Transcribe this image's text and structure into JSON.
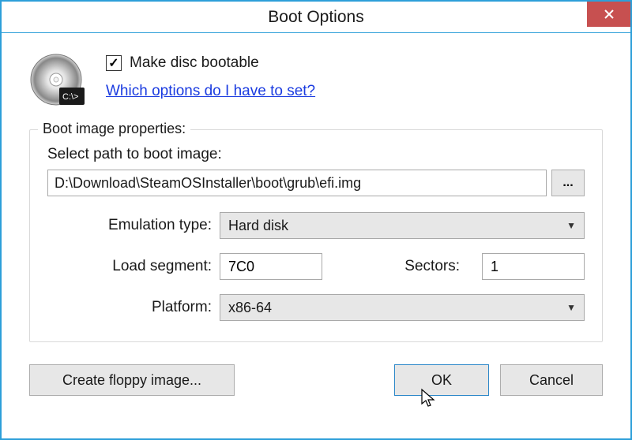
{
  "title": "Boot Options",
  "checkbox": {
    "label": "Make disc bootable",
    "checked": true
  },
  "help_link": "Which options do I have to set?",
  "group": {
    "legend": "Boot image properties:",
    "path_label": "Select path to boot image:",
    "path_value": "D:\\Download\\SteamOSInstaller\\boot\\grub\\efi.img",
    "browse_label": "...",
    "emulation_label": "Emulation type:",
    "emulation_value": "Hard disk",
    "load_segment_label": "Load segment:",
    "load_segment_value": "7C0",
    "sectors_label": "Sectors:",
    "sectors_value": "1",
    "platform_label": "Platform:",
    "platform_value": "x86-64"
  },
  "buttons": {
    "floppy": "Create floppy image...",
    "ok": "OK",
    "cancel": "Cancel"
  }
}
